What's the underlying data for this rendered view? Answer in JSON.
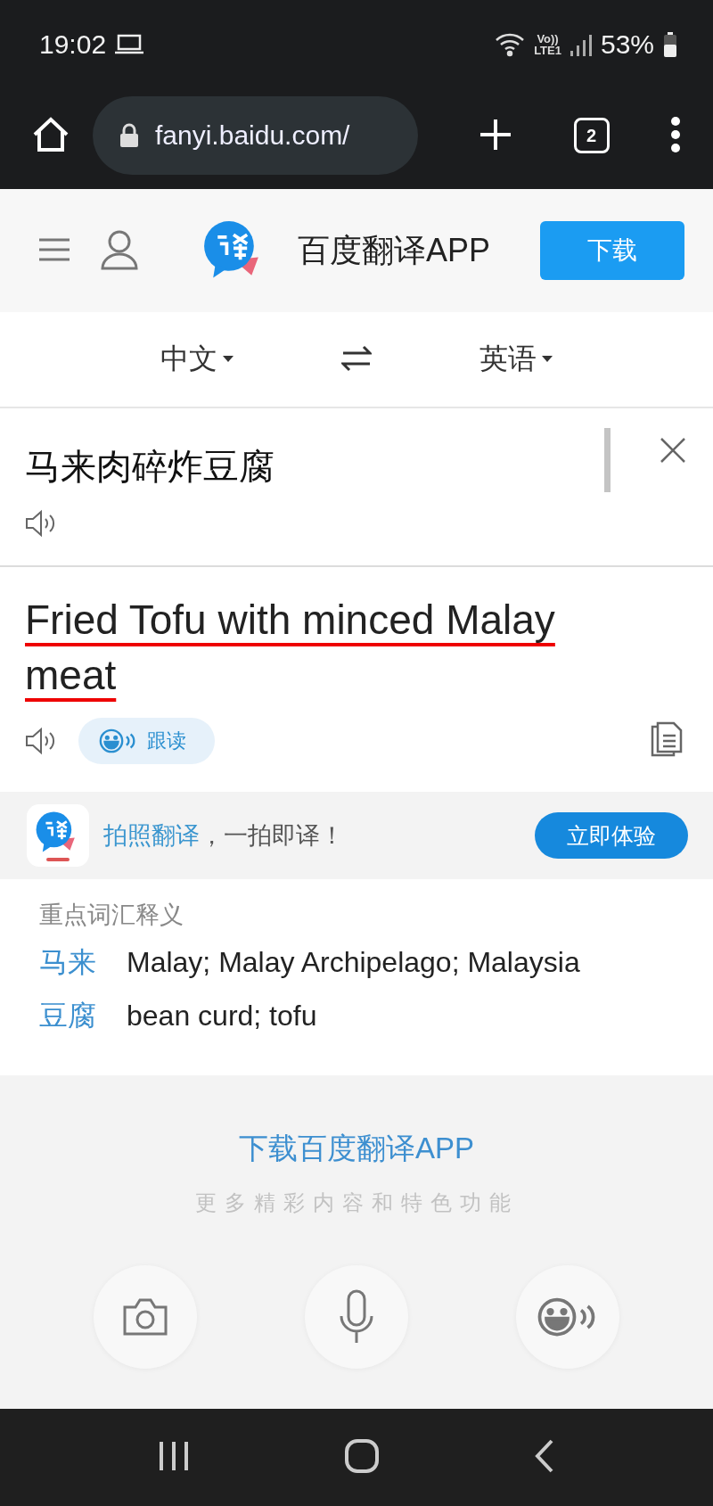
{
  "status_bar": {
    "time": "19:02",
    "volte_label": "Vo))",
    "lte_label": "LTE1",
    "battery": "53%"
  },
  "browser": {
    "url": "fanyi.baidu.com/",
    "tab_count": "2"
  },
  "header": {
    "app_title": "百度翻译APP",
    "download_button": "下载"
  },
  "languages": {
    "source": "中文",
    "target": "英语"
  },
  "input": {
    "text": "马来肉碎炸豆腐"
  },
  "output": {
    "text": "Fried Tofu with minced Malay meat",
    "underlined": true,
    "follow_read_button": "跟读"
  },
  "banner": {
    "highlight": "拍照翻译",
    "rest": "，一拍即译！",
    "button": "立即体验"
  },
  "vocabulary": {
    "title": "重点词汇释义",
    "entries": [
      {
        "word": "马来",
        "meaning": "Malay; Malay Archipelago; Malaysia"
      },
      {
        "word": "豆腐",
        "meaning": "bean curd; tofu"
      }
    ]
  },
  "promo": {
    "title": "下载百度翻译APP",
    "subtitle": "更多精彩内容和特色功能",
    "features": [
      {
        "kind": "camera"
      },
      {
        "kind": "microphone"
      },
      {
        "kind": "voice"
      }
    ]
  }
}
